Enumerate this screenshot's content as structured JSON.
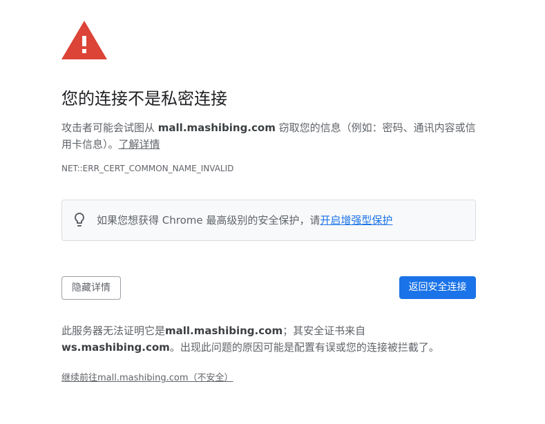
{
  "icon": {
    "name": "warning-triangle-icon"
  },
  "title": "您的连接不是私密连接",
  "explanation": {
    "prefix": "攻击者可能会试图从 ",
    "domain": "mall.mashibing.com",
    "suffix": " 窃取您的信息（例如：密码、通讯内容或信用卡信息）。",
    "learn_more_link": "了解详情"
  },
  "error_code": "NET::ERR_CERT_COMMON_NAME_INVALID",
  "enhanced_protection_banner": {
    "icon": "lightbulb-icon",
    "text": "如果您想获得 Chrome 最高级别的安全保护，请",
    "link": "开启增强型保护"
  },
  "buttons": {
    "details": "隐藏详情",
    "back_to_safety": "返回安全连接"
  },
  "details": {
    "text_1": "此服务器无法证明它是",
    "domain": "mall.mashibing.com",
    "text_2": "；其安全证书来自",
    "issuer_domain": "ws.mashibing.com",
    "text_3": "。出现此问题的原因可能是配置有误或您的连接被拦截了。"
  },
  "proceed_link": "继续前往mall.mashibing.com（不安全）",
  "colors": {
    "warning_red": "#db4437",
    "link_blue": "#1a73e8",
    "primary_button": "#1a73e8",
    "heading_text": "#202124",
    "body_text": "#5f6368",
    "emphasis_text": "#3c4043",
    "banner_background": "#f8f9fa",
    "banner_border": "#dadce0",
    "secondary_button_border": "#9aa0a6"
  }
}
